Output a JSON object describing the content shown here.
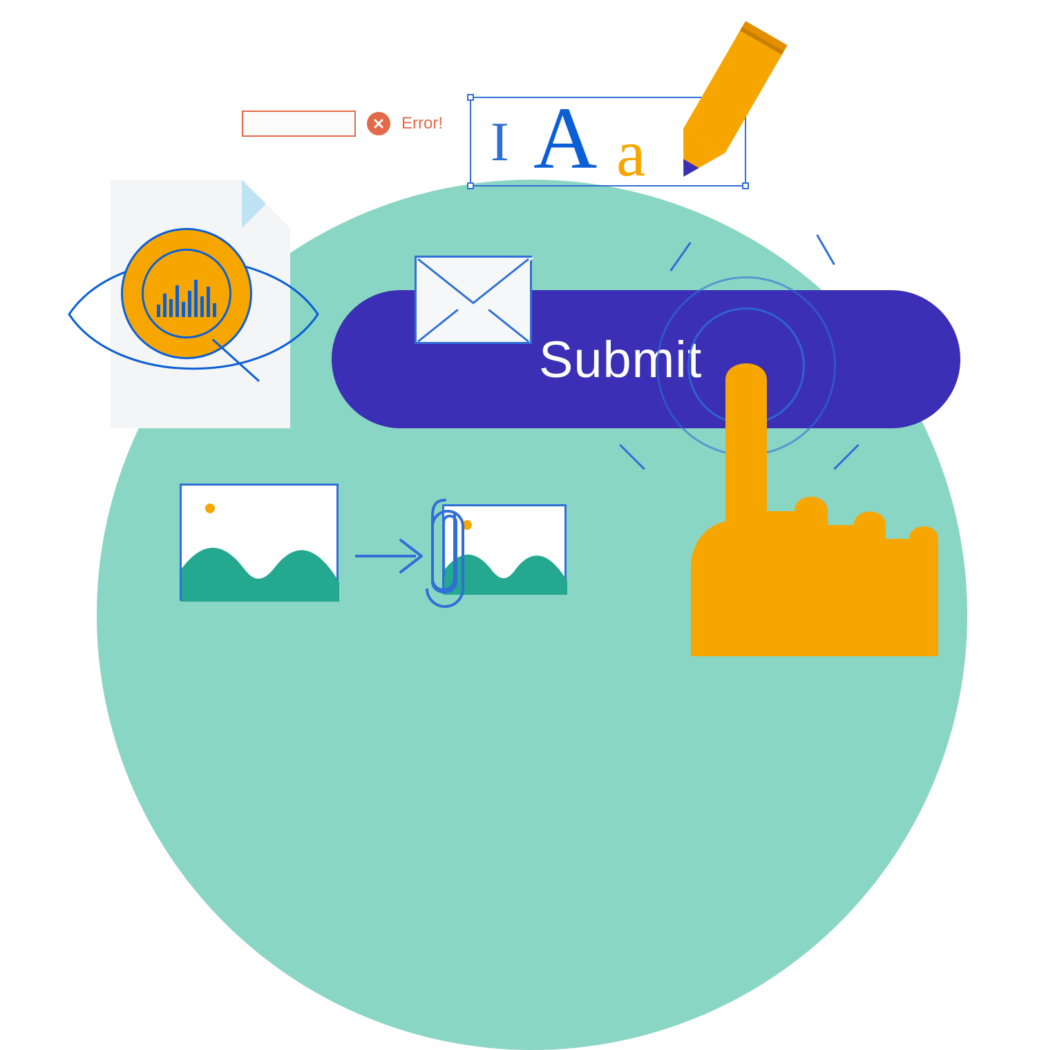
{
  "error": {
    "label": "Error!"
  },
  "typography": {
    "big_letter": "A",
    "small_letter": "a"
  },
  "submit": {
    "label": "Submit"
  },
  "colors": {
    "teal": "#8AD6C4",
    "indigo": "#3A2FB5",
    "blue": "#0B5FD6",
    "orange": "#F7A600",
    "error": "#E26A4A"
  }
}
